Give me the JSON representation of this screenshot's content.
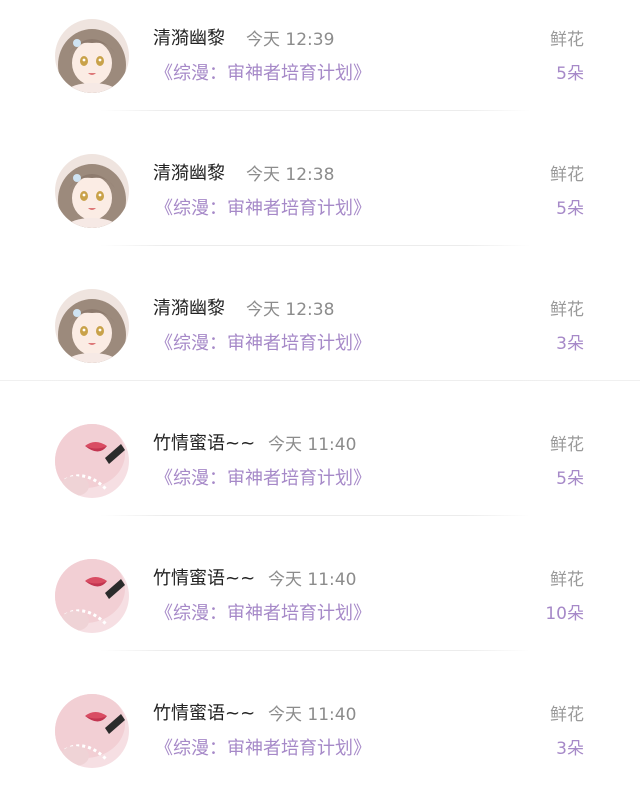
{
  "records": [
    {
      "user": "清漪幽黎",
      "time": "今天 12:39",
      "book": "《综漫：审神者培育计划》",
      "gift": "鲜花",
      "amount": "5朵",
      "avatar": "anime-girl"
    },
    {
      "user": "清漪幽黎",
      "time": "今天 12:38",
      "book": "《综漫：审神者培育计划》",
      "gift": "鲜花",
      "amount": "5朵",
      "avatar": "anime-girl"
    },
    {
      "user": "清漪幽黎",
      "time": "今天 12:38",
      "book": "《综漫：审神者培育计划》",
      "gift": "鲜花",
      "amount": "3朵",
      "avatar": "anime-girl"
    },
    {
      "user": "竹情蜜语~~",
      "time": "今天 11:40",
      "book": "《综漫：审神者培育计划》",
      "gift": "鲜花",
      "amount": "5朵",
      "avatar": "lips-closeup"
    },
    {
      "user": "竹情蜜语~~",
      "time": "今天 11:40",
      "book": "《综漫：审神者培育计划》",
      "gift": "鲜花",
      "amount": "10朵",
      "avatar": "lips-closeup"
    },
    {
      "user": "竹情蜜语~~",
      "time": "今天 11:40",
      "book": "《综漫：审神者培育计划》",
      "gift": "鲜花",
      "amount": "3朵",
      "avatar": "lips-closeup"
    }
  ],
  "colors": {
    "name": "#222222",
    "time": "#8c8c8c",
    "accent": "#a689c8",
    "gift": "#9a9a9a"
  }
}
